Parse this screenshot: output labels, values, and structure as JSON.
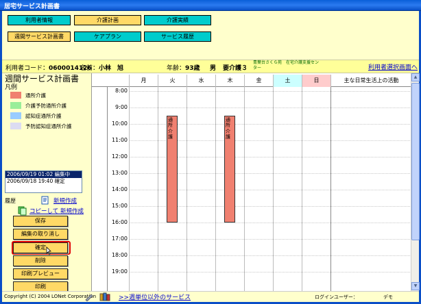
{
  "window": {
    "title": "居宅サービス計画書"
  },
  "nav": {
    "row1": [
      "利用者情報",
      "介護計画",
      "介護実績"
    ],
    "row2": [
      "週間サービス計画書",
      "ケアプラン",
      "サービス履歴"
    ],
    "active": "介護計画"
  },
  "user": {
    "code_label": "利用者コード：",
    "code": "0600014126",
    "name_label": "名前：",
    "name": "小林　旭",
    "age_label": "年齢：",
    "age": "93歳",
    "gender": "男",
    "care_level": "要介護３",
    "facility": "青葉台さくら苑　在宅介護支援センター",
    "select_link": "利用者選択画面へ"
  },
  "left": {
    "page_title": "週間サービス計画書",
    "legend_label": "凡例",
    "legend": [
      {
        "label": "通所介護",
        "color": "#f08070"
      },
      {
        "label": "介護予防通所介護",
        "color": "#99ee99"
      },
      {
        "label": "認知症通所介護",
        "color": "#99ccff"
      },
      {
        "label": "予防認知症通所介護",
        "color": "#dcdcf2"
      }
    ],
    "history_entries": [
      "2006/09/19 01:02  編集中",
      "2006/09/18 19:40  確定"
    ],
    "history_label": "履歴",
    "new_link": "新規作成",
    "copy_link": "コピーして 新規作成",
    "buttons": {
      "save": "保存",
      "undo": "編集の取り消し",
      "confirm": "確定",
      "delete": "削除",
      "preview": "印刷プレビュー",
      "print": "印刷"
    }
  },
  "calendar": {
    "days": [
      "月",
      "火",
      "水",
      "木",
      "金",
      "土",
      "日"
    ],
    "day_colors": {
      "土": "#ccffff",
      "日": "#ffcccc"
    },
    "activity_header": "主な日常生活上の活動",
    "hours": [
      "8:00",
      "9:00",
      "10:00",
      "11:00",
      "12:00",
      "13:00",
      "14:00",
      "15:00",
      "16:00",
      "17:00",
      "18:00",
      "19:00"
    ],
    "blocks": [
      {
        "day": "火",
        "label": "通所介護",
        "start": "9:30",
        "end": "16:00"
      },
      {
        "day": "木",
        "label": "通所介護",
        "start": "9:30",
        "end": "16:00"
      }
    ]
  },
  "footer": {
    "copyright": "Copyright (C) 2004 LONet Corporation",
    "other_services_link": ">>週単位以外のサービス",
    "login_label": "ログインユーザー：",
    "login_user": "デモ"
  }
}
